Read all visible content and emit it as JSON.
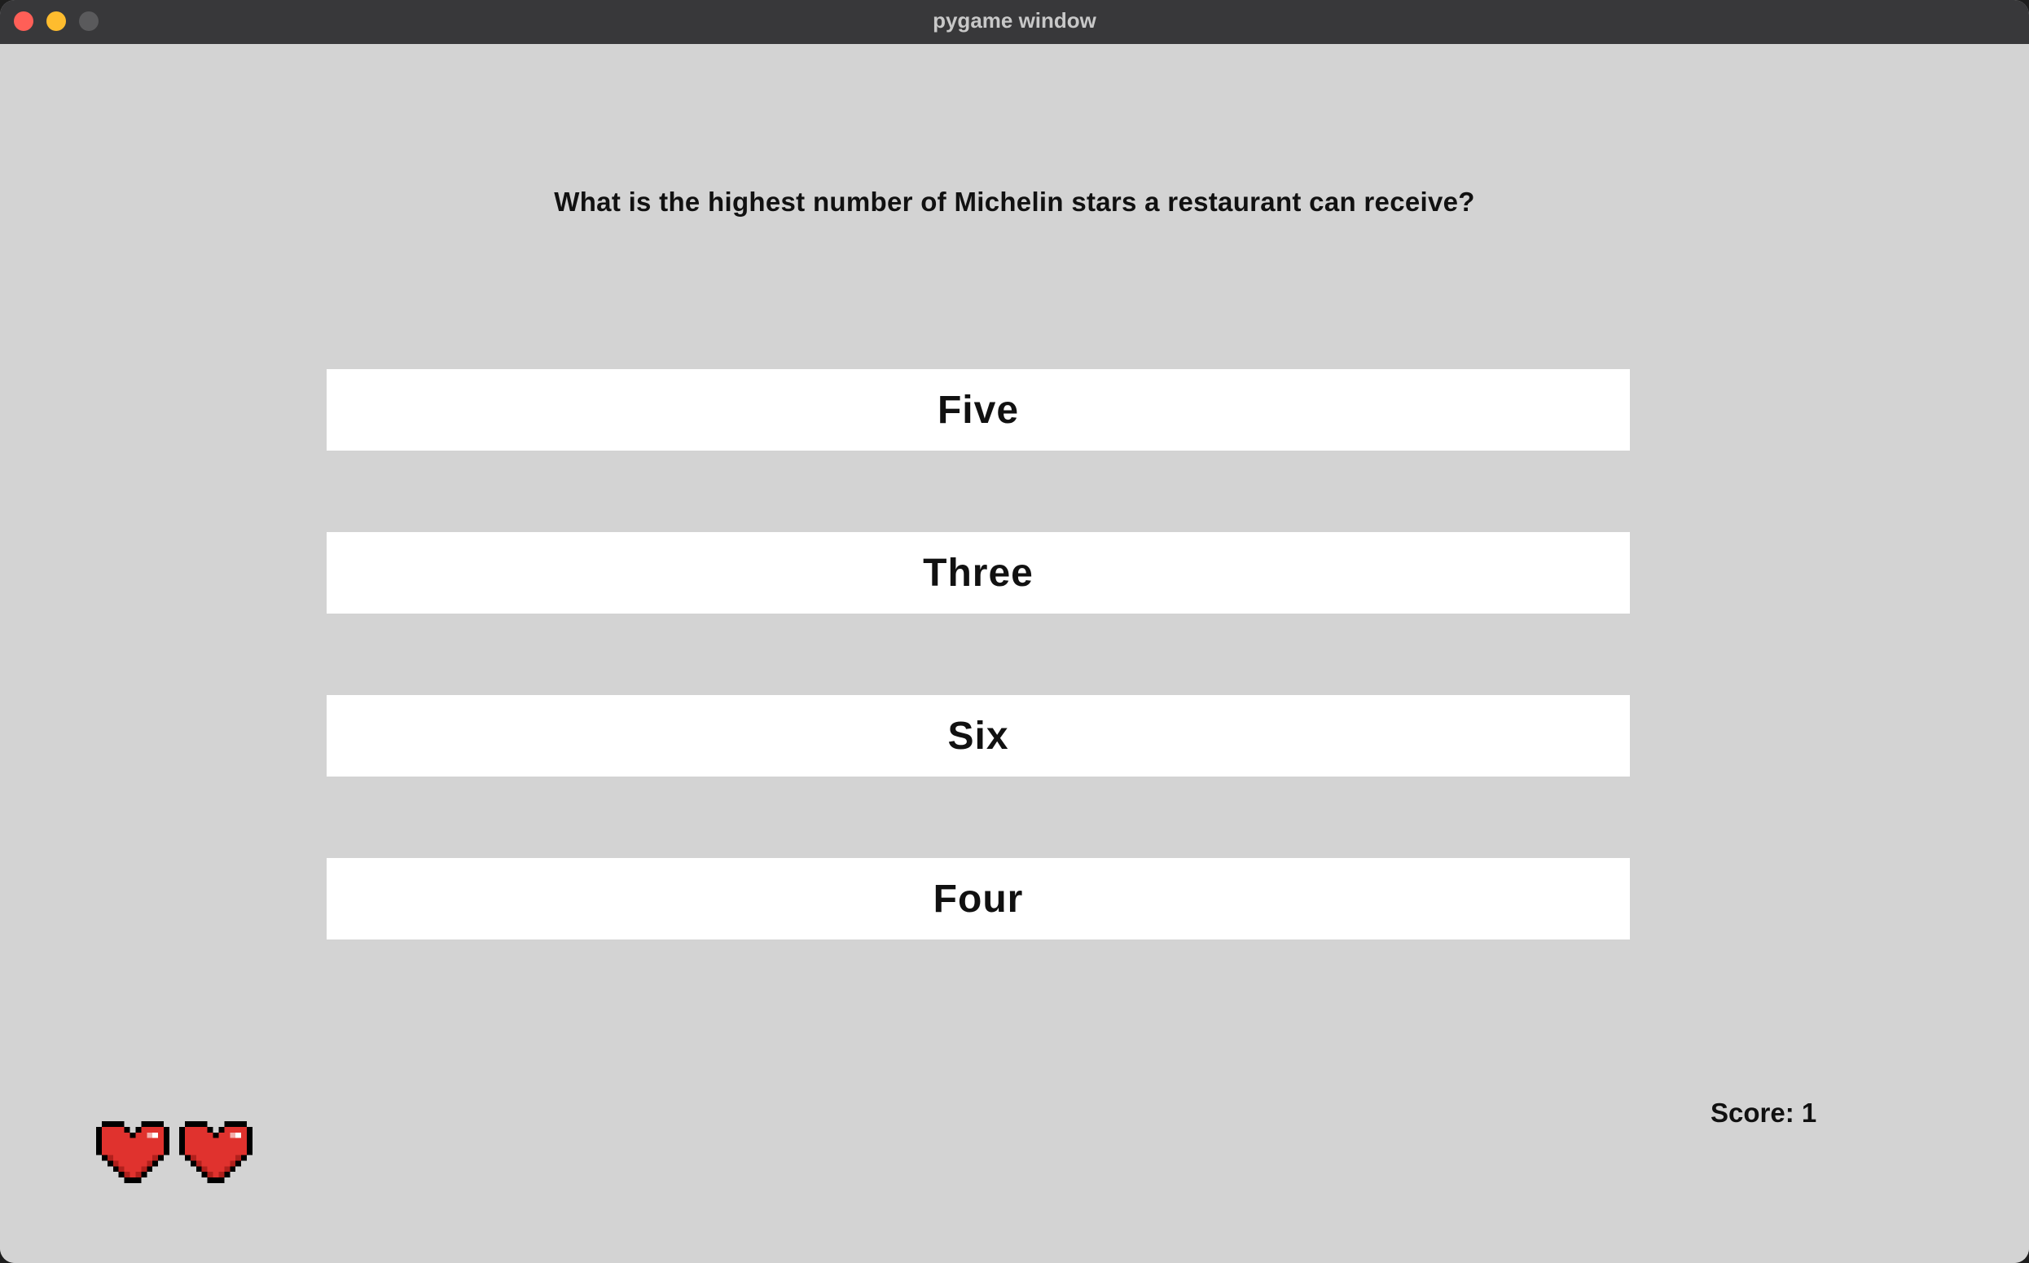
{
  "window": {
    "title": "pygame window",
    "controls": [
      "close",
      "minimize",
      "maximize"
    ]
  },
  "game": {
    "question": "What is the highest number of Michelin stars a restaurant can receive?",
    "answers": [
      {
        "label": "Five"
      },
      {
        "label": "Three"
      },
      {
        "label": "Six"
      },
      {
        "label": "Four"
      }
    ],
    "score_text": "Score: 1",
    "lives": {
      "count": 2,
      "icon": "heart-icon",
      "color": "#e0322e"
    }
  },
  "colors": {
    "background": "#d3d3d3",
    "answer_box": "#ffffff",
    "text": "#111111",
    "titlebar": "#38383a"
  }
}
